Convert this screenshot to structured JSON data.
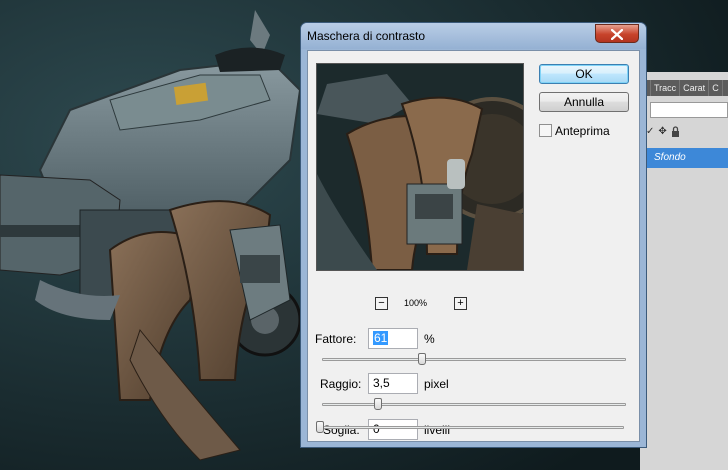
{
  "dialog": {
    "title": "Maschera di contrasto",
    "ok_label": "OK",
    "cancel_label": "Annulla",
    "preview_label": "Anteprima",
    "preview_checked": false,
    "zoom": "100%",
    "zoom_out_symbol": "−",
    "zoom_in_symbol": "+",
    "amount": {
      "label": "Fattore:",
      "value": "61",
      "unit": "%"
    },
    "radius": {
      "label": "Raggio:",
      "value": "3,5",
      "unit": "pixel"
    },
    "threshold": {
      "label": "Soglia:",
      "value": "0",
      "unit": "livelli"
    }
  },
  "panel": {
    "tabs": [
      "",
      "Tracc",
      "Carat",
      "C"
    ],
    "layer_name": "Sfondo",
    "icons": [
      "check-icon",
      "move-icon",
      "lock-icon"
    ]
  },
  "colors": {
    "title_gradient_top": "#b9cde6",
    "close_button": "#c7432b",
    "ok_border": "#3c7fb1",
    "layer_selected": "#3d88d8"
  }
}
